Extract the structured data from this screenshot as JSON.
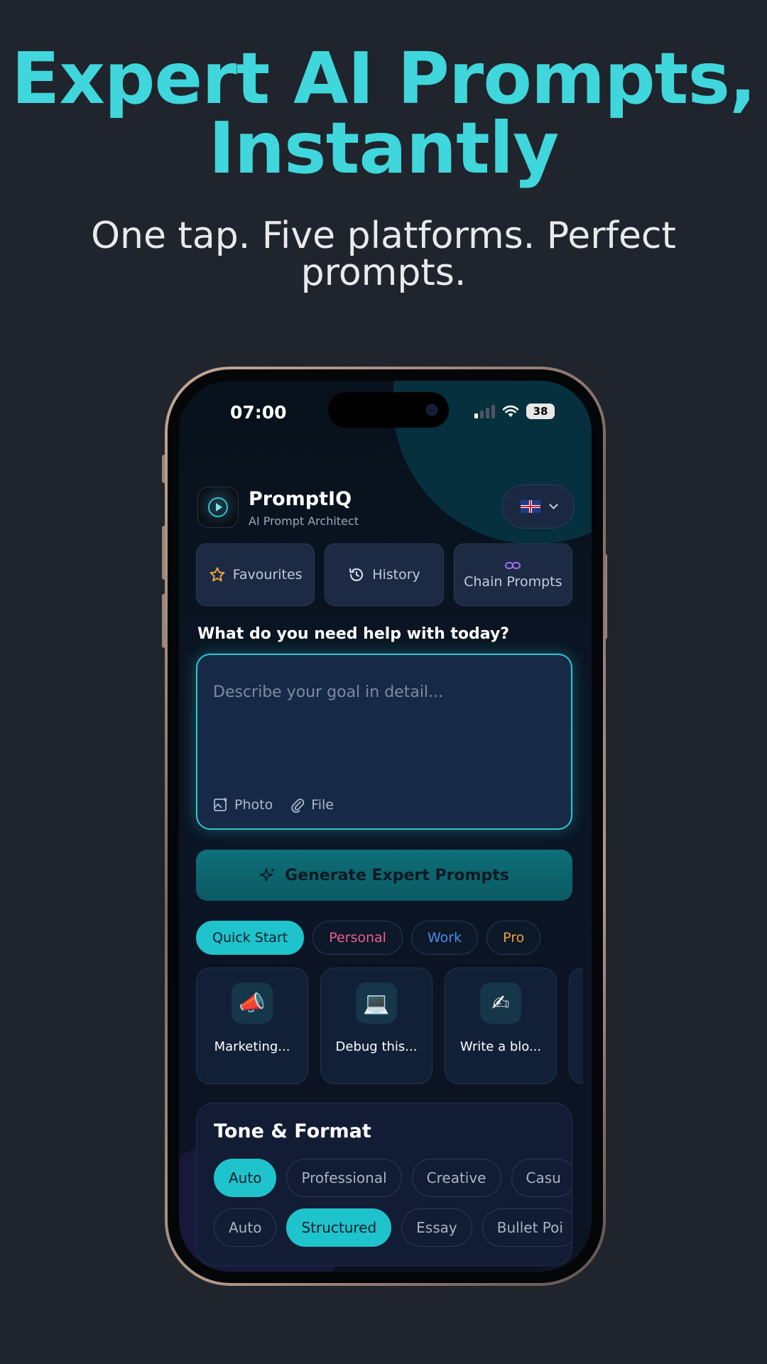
{
  "promo": {
    "headline_line1": "Expert AI Prompts,",
    "headline_line2": "Instantly",
    "subhead_line1": "One tap. Five platforms. Perfect",
    "subhead_line2": "prompts."
  },
  "status_bar": {
    "time": "07:00",
    "battery": "38"
  },
  "header": {
    "app_name": "PromptIQ",
    "tagline": "AI Prompt Architect",
    "language_icon": "uk-flag-icon"
  },
  "quick_actions": [
    {
      "label": "Favourites",
      "icon": "star-icon"
    },
    {
      "label": "History",
      "icon": "history-icon"
    },
    {
      "label": "Chain Prompts",
      "icon": "link-icon"
    }
  ],
  "goal": {
    "question": "What do you need help with today?",
    "placeholder": "Describe your goal in detail...",
    "attach_photo": "Photo",
    "attach_file": "File"
  },
  "generate_button": {
    "label": "Generate Expert Prompts",
    "icon": "sparkle-icon"
  },
  "categories": [
    {
      "label": "Quick Start",
      "color": "#062028",
      "active": true
    },
    {
      "label": "Personal",
      "color": "#ef5e93"
    },
    {
      "label": "Work",
      "color": "#4d8df0"
    },
    {
      "label": "Pro",
      "color": "#f0a23a"
    }
  ],
  "templates": [
    {
      "label": "Marketing...",
      "emoji": "📣",
      "icon": "megaphone-icon"
    },
    {
      "label": "Debug this...",
      "emoji": "💻",
      "icon": "laptop-icon"
    },
    {
      "label": "Write a blo...",
      "emoji": "✍",
      "icon": "writing-hand-icon"
    }
  ],
  "tone_format": {
    "title": "Tone & Format",
    "tones": [
      "Auto",
      "Professional",
      "Creative",
      "Casu"
    ],
    "active_tone": "Auto",
    "formats": [
      "Auto",
      "Structured",
      "Essay",
      "Bullet Poi"
    ],
    "active_format": "Structured"
  },
  "colors": {
    "accent": "#1fc3cc",
    "headline": "#3fd6dc",
    "background": "#20242c"
  }
}
